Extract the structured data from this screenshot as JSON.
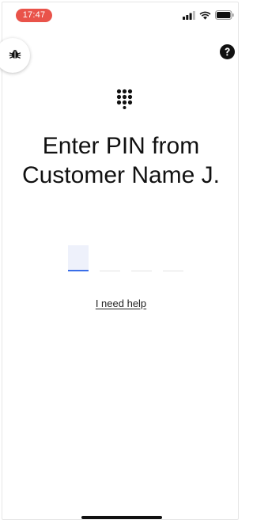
{
  "status_bar": {
    "time": "17:47",
    "time_pill_color": "#e9534a",
    "icons": [
      "cellular-signal-icon",
      "wifi-icon",
      "battery-icon"
    ]
  },
  "toolbar": {
    "debug_icon": "bug-icon",
    "help_icon": "question-circle-icon"
  },
  "header": {
    "icon": "keypad-icon",
    "title": "Enter PIN from Customer Name J."
  },
  "pin_input": {
    "length": 4,
    "values": [
      "",
      "",
      "",
      ""
    ],
    "active_index": 0,
    "active_color": "#3a6ee8"
  },
  "help_link": {
    "label": "I need help"
  }
}
